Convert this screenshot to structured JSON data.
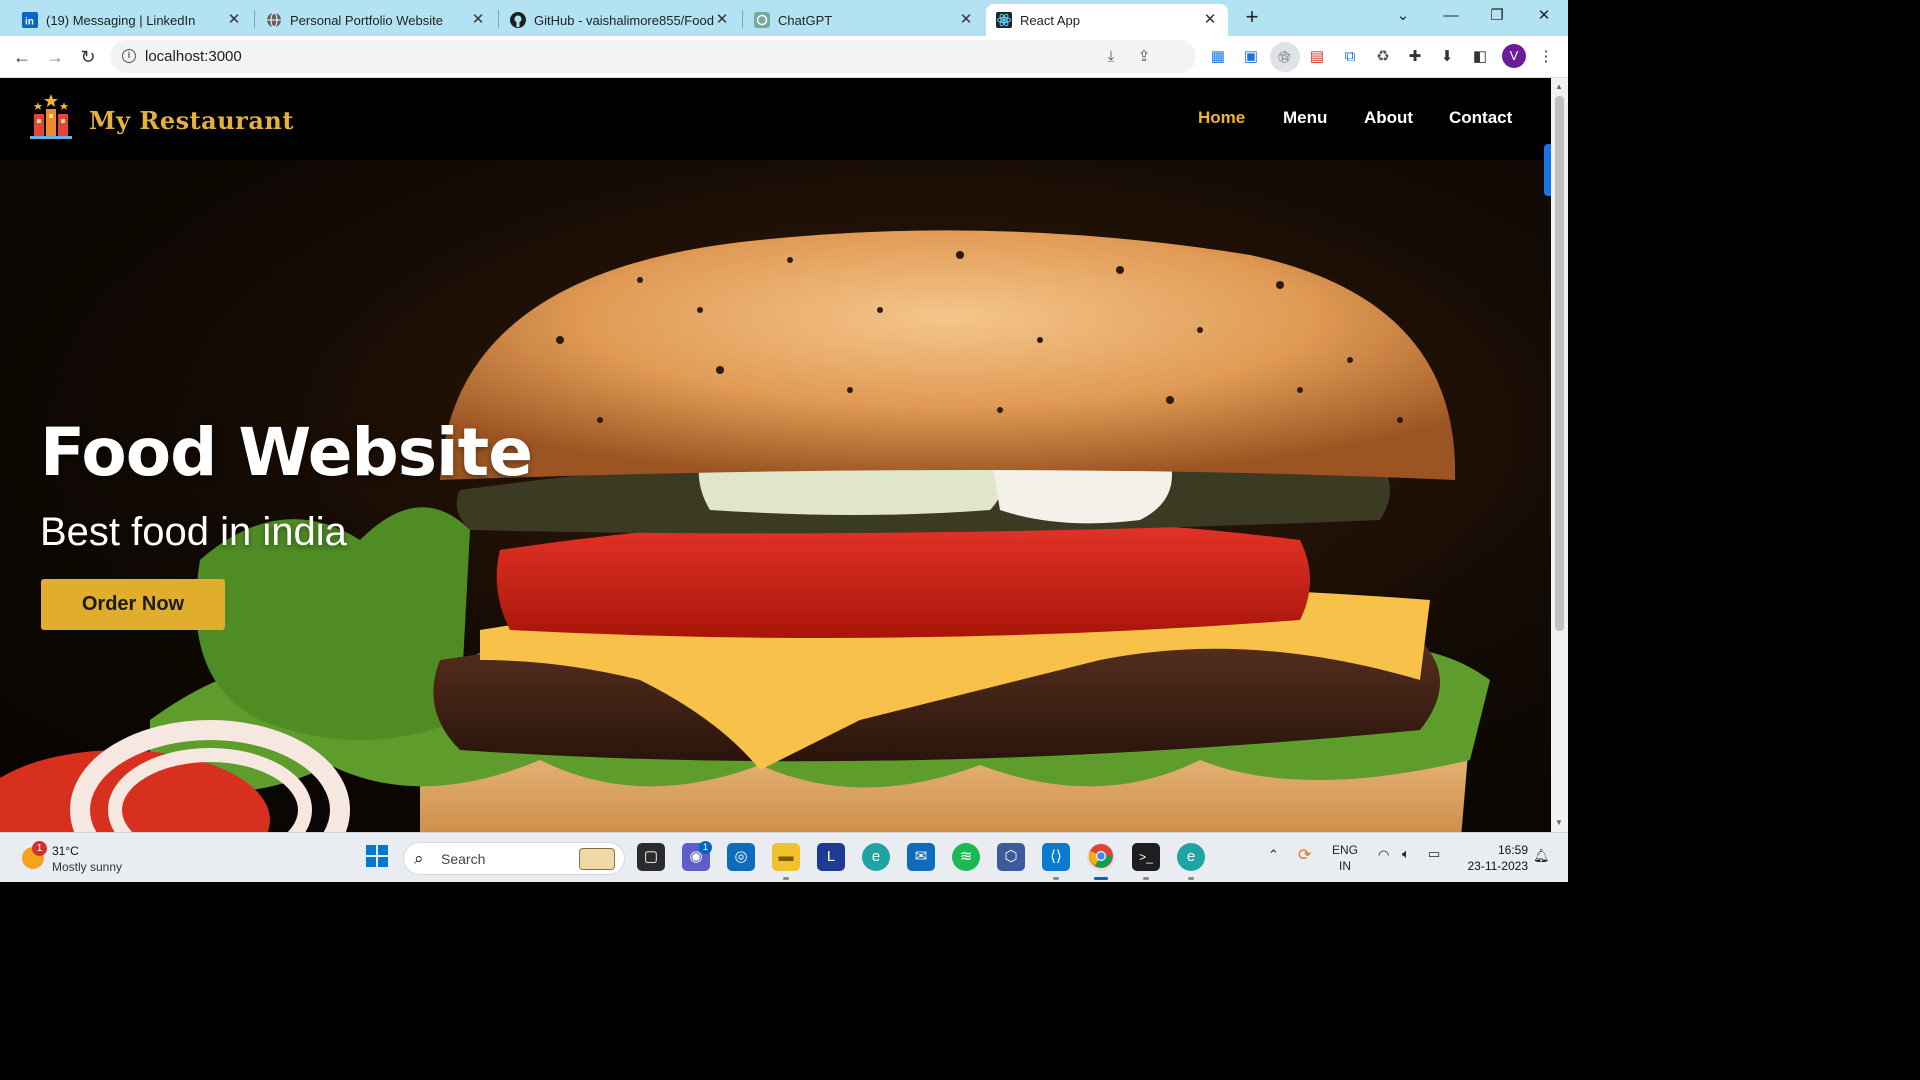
{
  "browser": {
    "tabs": [
      {
        "title": "(19) Messaging | LinkedIn",
        "icon": "linkedin-icon",
        "active": false
      },
      {
        "title": "Personal Portfolio Website",
        "icon": "globe-icon",
        "active": false
      },
      {
        "title": "GitHub - vaishalimore855/Food-",
        "icon": "github-icon",
        "active": false
      },
      {
        "title": "ChatGPT",
        "icon": "chatgpt-icon",
        "active": false
      },
      {
        "title": "React App",
        "icon": "react-icon",
        "active": true
      }
    ],
    "url": "localhost:3000",
    "profile_initial": "V"
  },
  "site": {
    "logo_text": "My Restaurant",
    "nav": [
      {
        "label": "Home",
        "active": true
      },
      {
        "label": "Menu",
        "active": false
      },
      {
        "label": "About",
        "active": false
      },
      {
        "label": "Contact",
        "active": false
      }
    ],
    "hero": {
      "title": "Food Website",
      "subtitle": "Best food in india",
      "cta": "Order Now"
    }
  },
  "taskbar": {
    "weather": {
      "temp": "31°C",
      "condition": "Mostly sunny",
      "badge": "1"
    },
    "search_label": "Search",
    "lang_line1": "ENG",
    "lang_line2": "IN",
    "time": "16:59",
    "date": "23-11-2023",
    "meet_badge": "1"
  },
  "colors": {
    "tabstrip": "#b3e3f2",
    "accent": "#f0b429",
    "button": "#e0ad2c",
    "logo": "#e6b13a"
  }
}
